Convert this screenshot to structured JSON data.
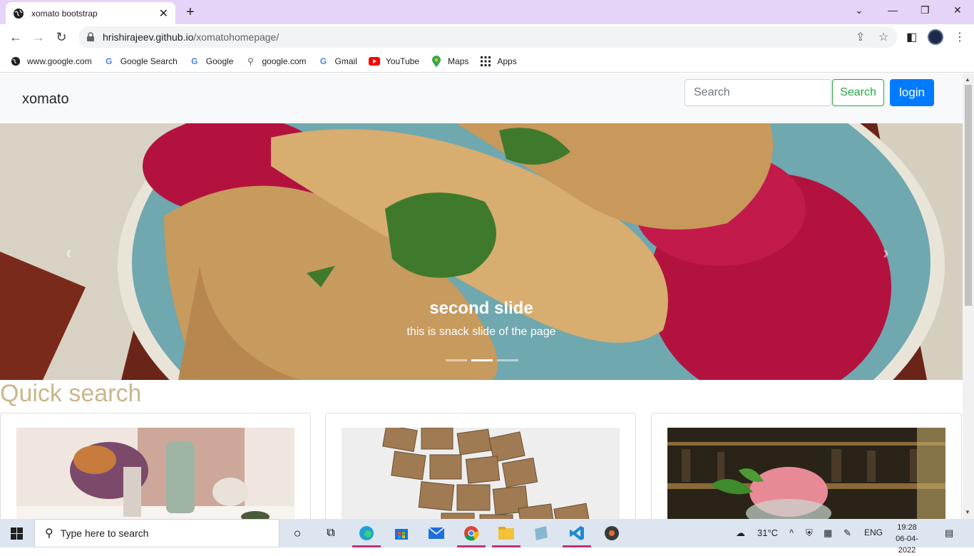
{
  "browser": {
    "tab_title": "xomato bootstrap",
    "url_host": "hrishirajeev.github.io",
    "url_path": "/xomatohomepage/",
    "bookmarks": [
      {
        "label": "www.google.com",
        "icon": "globe-icon"
      },
      {
        "label": "Google Search",
        "icon": "google-g-icon"
      },
      {
        "label": "Google",
        "icon": "google-g-icon"
      },
      {
        "label": "google.com",
        "icon": "search-icon"
      },
      {
        "label": "Gmail",
        "icon": "google-g-icon"
      },
      {
        "label": "YouTube",
        "icon": "youtube-icon"
      },
      {
        "label": "Maps",
        "icon": "maps-pin-icon"
      },
      {
        "label": "Apps",
        "icon": "apps-grid-icon"
      }
    ]
  },
  "navbar": {
    "brand": "xomato",
    "search_placeholder": "Search",
    "search_button": "Search",
    "login_button": "login"
  },
  "carousel": {
    "caption_title": "second slide",
    "caption_text": "this is snack slide of the page",
    "slides": 3,
    "active_slide": 2
  },
  "quick_search": {
    "title": "Quick search",
    "cards": [
      {
        "image": "table-flowers-photo"
      },
      {
        "image": "scrabble-tiles-photo"
      },
      {
        "image": "cocktail-bar-photo"
      }
    ]
  },
  "taskbar": {
    "search_placeholder": "Type here to search",
    "weather": "31°C",
    "language": "ENG",
    "time": "19:28",
    "date": "06-04-2022"
  },
  "colors": {
    "titlebar": "#e5d4f7",
    "login": "#007bff",
    "search_outline": "#28a745",
    "quick_search_title": "#cbb68a"
  }
}
